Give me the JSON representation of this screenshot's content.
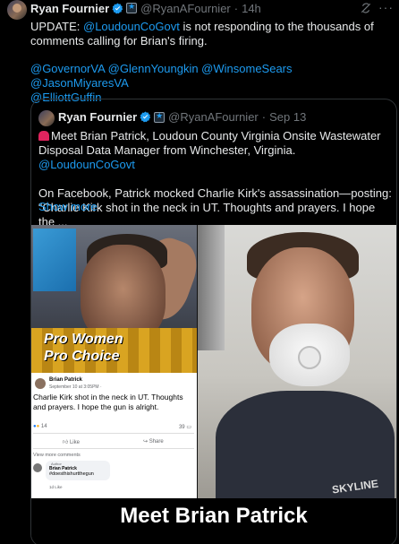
{
  "tweet": {
    "author_name": "Ryan Fournier",
    "handle": "@RyanAFournier",
    "time": "14h",
    "text_prefix": "UPDATE: ",
    "text_mention": "@LoudounCoGovt",
    "text_suffix": " is not responding to the thousands of comments calling for Brian's firing.",
    "mentions_line1": "@GovernorVA @GlennYoungkin @WinsomeSears @JasonMiyaresVA",
    "mentions_line2": "@ElliottGuffin"
  },
  "quote": {
    "author_name": "Ryan Fournier",
    "handle": "@RyanAFournier",
    "date": "Sep 13",
    "line1": "Meet Brian Patrick, Loudoun County Virginia Onsite Wastewater Disposal Data Manager from Winchester, Virginia. ",
    "line1_mention": "@LoudounCoGovt",
    "line2": "On Facebook, Patrick mocked Charlie Kirk's assassination—posting: “Charlie Kirk shot in the neck in UT. Thoughts and prayers. I hope the ...",
    "show_more": "Show more"
  },
  "media": {
    "banner_line1": "Pro Women",
    "banner_line2": "Pro Choice",
    "fb_name": "Brian Patrick",
    "fb_date": "September 10 at 3:05PM · ",
    "fb_text": "Charlie Kirk shot in the neck in UT. Thoughts and prayers. I hope the gun is alright.",
    "fb_reactions": "14",
    "fb_count": "39",
    "fb_like": "Like",
    "fb_share": "Share",
    "fb_view_more": "View more comments",
    "fb_comment_author_tag": "Author",
    "fb_comment_name": "Brian Patrick",
    "fb_comment_text": "#doesthishurtthegun",
    "fb_comment_time": "1d   Like",
    "shirt_text": "SKYLINE",
    "caption": "Meet Brian Patrick"
  },
  "icons": {
    "verified": "verified-badge-icon",
    "affiliate": "affiliate-badge-icon",
    "grok": "grok-icon",
    "more": "more-options-icon",
    "siren": "siren-emoji-icon"
  },
  "colors": {
    "link": "#1d9bf0",
    "background": "#000000",
    "muted": "#71767b"
  }
}
